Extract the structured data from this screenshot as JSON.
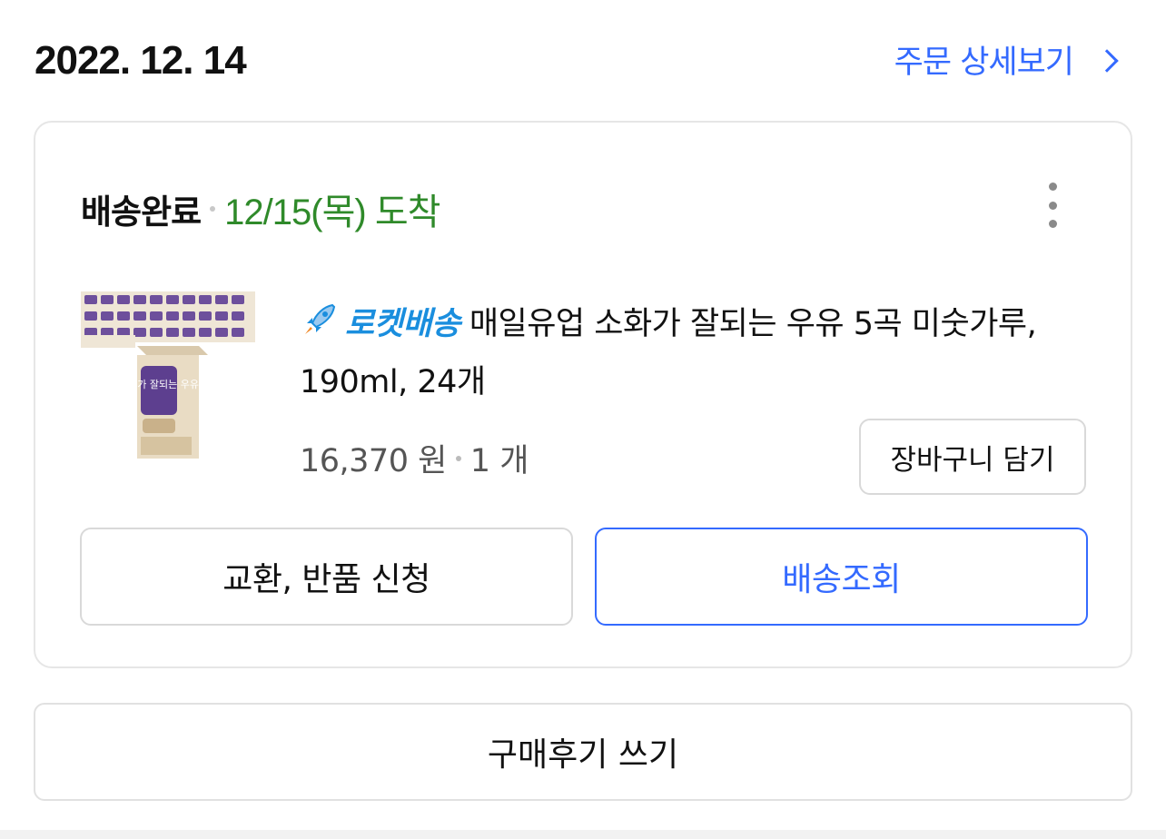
{
  "header": {
    "order_date": "2022. 12. 14",
    "detail_link_label": "주문 상세보기"
  },
  "order": {
    "status": "배송완료",
    "arrival": "12/15(목) 도착",
    "product": {
      "badge": "로켓배송",
      "title": "매일유업 소화가 잘되는 우유 5곡 미숫가루, 190ml, 24개",
      "image_text": "소화가 잘되는 우유",
      "price": "16,370 원",
      "quantity": "1 개"
    },
    "cart_button": "장바구니 담기",
    "return_button": "교환, 반품 신청",
    "track_button": "배송조회"
  },
  "review_button": "구매후기 쓰기",
  "colors": {
    "accent_blue": "#346aff",
    "arrival_green": "#2f8a2a",
    "rocket_blue": "#1a8ede"
  },
  "icons": [
    "chevron-right-icon",
    "more-vertical-icon",
    "rocket-icon"
  ]
}
